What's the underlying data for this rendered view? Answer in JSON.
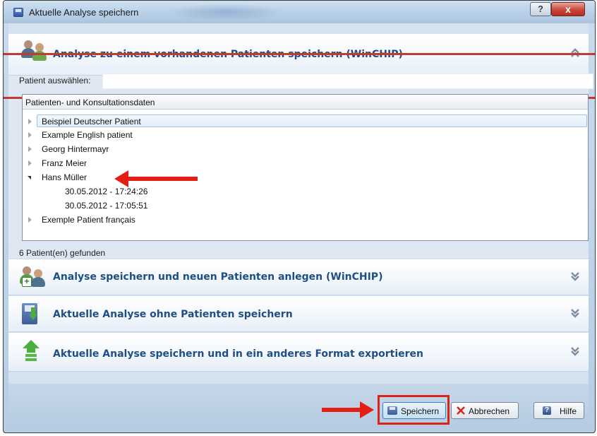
{
  "window": {
    "title": "Aktuelle Analyse speichern",
    "help_glyph": "?",
    "close_glyph": "x"
  },
  "section_existing": {
    "title": "Analyse zu einem vorhandenen Patienten speichern (WinCHIP)",
    "icon": "users-icon"
  },
  "patient_select": {
    "label": "Patient auswählen:",
    "value": ""
  },
  "tree": {
    "header": "Patienten- und Konsultationsdaten",
    "items": [
      {
        "label": "Beispiel Deutscher Patient",
        "expanded": false
      },
      {
        "label": "Example English patient",
        "expanded": false
      },
      {
        "label": "Georg Hintermayr",
        "expanded": false
      },
      {
        "label": "Franz Meier",
        "expanded": false
      },
      {
        "label": "Hans Müller",
        "expanded": true,
        "children": [
          "30.05.2012 - 17:24:26",
          "30.05.2012 - 17:05:51"
        ]
      },
      {
        "label": "Exemple Patient français",
        "expanded": false
      }
    ]
  },
  "found_text": "6 Patient(en) gefunden",
  "section_new": {
    "title": "Analyse speichern und neuen Patienten anlegen (WinCHIP)",
    "icon": "add-user-icon"
  },
  "section_nopatient": {
    "title": "Aktuelle Analyse ohne Patienten speichern",
    "icon": "save-down-icon"
  },
  "section_export": {
    "title": "Aktuelle Analyse speichern und in ein anderes Format exportieren",
    "icon": "export-arrow-icon"
  },
  "buttons": {
    "save": "Speichern",
    "cancel": "Abbrechen",
    "help": "Hilfe"
  },
  "colors": {
    "accent": "#1f4f82",
    "annotation_red": "#e51e14"
  }
}
